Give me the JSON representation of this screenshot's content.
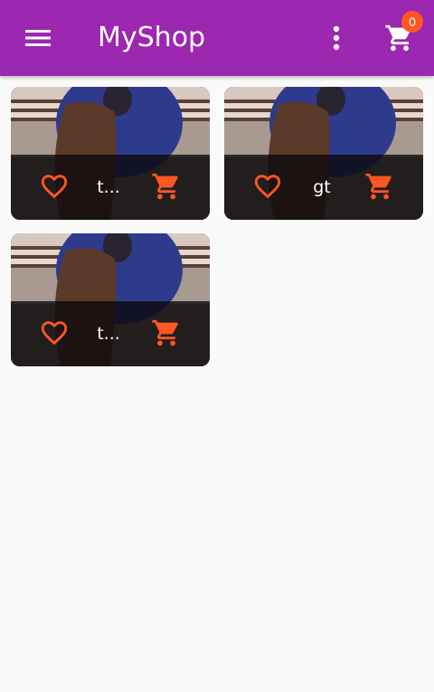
{
  "app_bar": {
    "title": "MyShop",
    "background_color": "#9c27b0",
    "menu_icon": "hamburger-menu-icon",
    "more_icon": "more-vert-icon",
    "cart_icon": "shopping-cart-icon",
    "cart_count": "0",
    "badge_color": "#ff5722"
  },
  "products": [
    {
      "name": "t...",
      "favorite_icon": "heart-outline-icon",
      "cart_icon": "add-to-cart-icon"
    },
    {
      "name": "gt",
      "favorite_icon": "heart-outline-icon",
      "cart_icon": "add-to-cart-icon"
    },
    {
      "name": "t...",
      "favorite_icon": "heart-outline-icon",
      "cart_icon": "add-to-cart-icon"
    }
  ],
  "accent_color": "#ff5722"
}
